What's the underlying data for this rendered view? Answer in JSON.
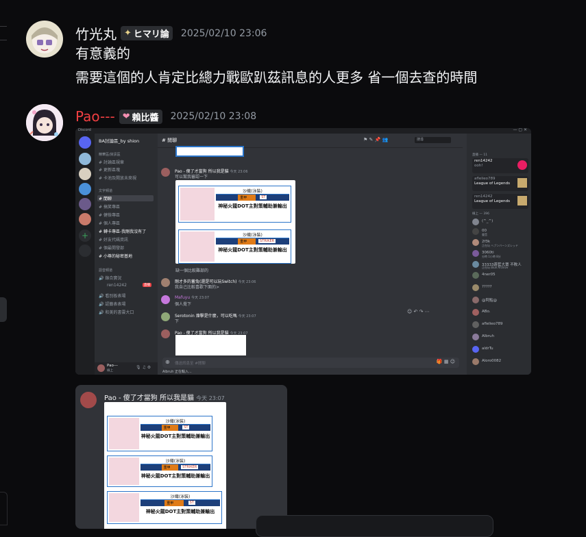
{
  "messages": [
    {
      "username": "竹光丸",
      "badge": "ヒマリ論",
      "timestamp": "2025/02/10 23:06",
      "lines": [
        "有意義的",
        "需要這個的人肯定比總力戰歐趴茲訊息的人更多 省一個去查的時間"
      ],
      "name_color": "#f2f3f5"
    },
    {
      "username": "Pao---",
      "badge": "賴比醬",
      "timestamp": "2025/02/10 23:08",
      "name_color": "#f23f42"
    }
  ],
  "embedded_screenshot": {
    "app": "Discord",
    "server": "BA討論區_by shion",
    "channel_header": "閒聊",
    "search_placeholder": "搜尋",
    "channels": [
      "精華區/資訊區",
      "討論區規章",
      "更新區塊",
      "卡池及開放未來視",
      "文字頻道",
      "閒聊",
      "搞笑專區",
      "健檢專區",
      "個人專區",
      "轉卡專區-我剛我沒有了",
      "好友代碼資訊",
      "個最開發部",
      "小尊的秘密基地",
      "語音頻道",
      "錄合實況",
      "ren14242",
      "看別板表場",
      "認籤表表場",
      "和美的書雲大口"
    ],
    "live_label": "直播",
    "messages": [
      {
        "author": "Pao - 傻了才當狗 所以我是貓",
        "time": "今天 23:06",
        "text": "可以幫我審認一下"
      },
      {
        "author": "",
        "time": "",
        "text": "缺一個比較難部的"
      },
      {
        "author": "剛才多的蓄兔(還是可以玩Switch)",
        "time": "今天 23:06",
        "text": "我自己比較喜歡下面的>"
      },
      {
        "author": "Mafuyu",
        "time": "今天 23:07",
        "text": "個人覺下"
      },
      {
        "author": "Serotonin 煉擊是什麼，可以吃嗎",
        "time": "今天 23:07",
        "text": "下"
      },
      {
        "author": "Pao - 傻了才當狗 所以我是貓",
        "time": "今天 23:07",
        "text": ""
      }
    ],
    "card": {
      "name": "沙織(泳裝)",
      "role": "重甲",
      "tag1": "ST",
      "tag2": "STRIKER",
      "caption": "神秘火龍DOT主對策輔助兼輸出"
    },
    "input_placeholder": "傳送訊息至 #閒聊",
    "typing": "Albruh 正在輸入...",
    "user_name": "Pao---",
    "user_status": "線上",
    "members_header": "直播 — 11",
    "members": [
      {
        "name": "ren14242",
        "sub": "ooh!"
      },
      {
        "name": "aflelieo789",
        "sub": "League of Legends"
      },
      {
        "name": "ren14242",
        "sub": "League of Legends"
      },
      {
        "name": "線上 — 396",
        "sub": ""
      },
      {
        "name": "(^_^)",
        "sub": ""
      },
      {
        "name": "00",
        "sub": "聲音"
      },
      {
        "name": "2f3k",
        "sub": "正在玩 ヘブンバーンズレッド"
      },
      {
        "name": "3060ti",
        "sub": "分時 1小時 8分"
      },
      {
        "name": "33333蒼藍大寶 不敗人",
        "sub": "正在玩 Blue Archive"
      },
      {
        "name": "4ner05",
        "sub": ""
      },
      {
        "name": "?????",
        "sub": ""
      },
      {
        "name": "@阿點@",
        "sub": ""
      },
      {
        "name": "ABo.",
        "sub": ""
      },
      {
        "name": "aflelieo789",
        "sub": ""
      },
      {
        "name": "Albruh",
        "sub": ""
      },
      {
        "name": "aldrTu",
        "sub": ""
      },
      {
        "name": "Aloro0082",
        "sub": ""
      }
    ]
  },
  "cropped_message": {
    "author": "Pao - 傻了才當狗 所以我是貓",
    "time": "今天 23:07"
  }
}
